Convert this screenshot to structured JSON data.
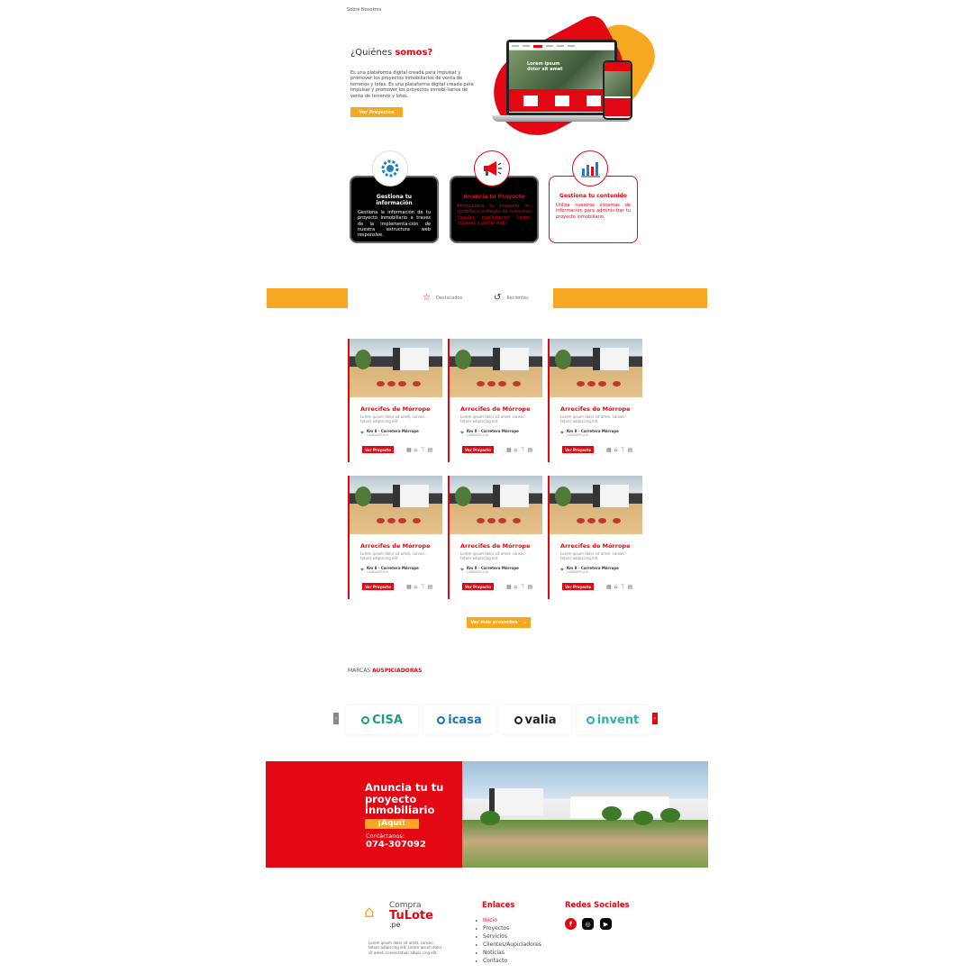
{
  "breadcrumb": "Sobre Nosotros",
  "hero": {
    "title_a": "¿Quiénes ",
    "title_b": "somos?",
    "text": "Es una plataforma digital creada para impulsar y promover los proyectos inmobiliarios de venta de terrenos y lotes. Es una plataforma digital creada para impulsar y promover los proyectos inmobi-liarios de venta de terrenos y lotes.",
    "button": "Ver Proyectos",
    "mockup_headline": "Lorem ipsum dolor sit amet"
  },
  "features": [
    {
      "icon": "gear-search-icon",
      "title": "Gestiona tu información",
      "text": "Gestiona la información de tu proyecto inmobiliario a través de la implementa-ción de nuestra estructura web responsive."
    },
    {
      "icon": "megaphone-icon",
      "title": "Anuncia tu Proyecto",
      "text": "Promociona tu proyecto in-mobiliario a través de nues-tros canales publicitarios (redes sociales y portal web)"
    },
    {
      "icon": "chart-icon",
      "title": "Gestiona tu contenido",
      "text": "Utiliza nuestros sistemas de información para adminis-trar tu proyecto inmobiliario."
    }
  ],
  "tabs": {
    "featured": "Destacados",
    "recent": "Recientes"
  },
  "project_cards": [
    {
      "title": "Arrecifes de Mórrope",
      "desc": "Lorem ipsum dolor sit amet, consec-tetuer adipiscing elit.",
      "location": "Km 8 - Carretera Mórrope",
      "location_sub": "LAMBAYEQUE",
      "button": "Ver Proyecto"
    },
    {
      "title": "Arrecifes de Mórrope",
      "desc": "Lorem ipsum dolor sit amet, consec-tetuer adipiscing elit.",
      "location": "Km 8 - Carretera Mórrope",
      "location_sub": "LAMBAYEQUE",
      "button": "Ver Proyecto"
    },
    {
      "title": "Arrecifes de Mórrope",
      "desc": "Lorem ipsum dolor sit amet, consec-tetuer adipiscing elit.",
      "location": "Km 8 - Carretera Mórrope",
      "location_sub": "LAMBAYEQUE",
      "button": "Ver Proyecto"
    },
    {
      "title": "Arrecifes de Mórrope",
      "desc": "Lorem ipsum dolor sit amet, consec-tetuer adipiscing elit.",
      "location": "Km 8 - Carretera Mórrope",
      "location_sub": "LAMBAYEQUE",
      "button": "Ver Proyecto"
    },
    {
      "title": "Arrecifes de Mórrope",
      "desc": "Lorem ipsum dolor sit amet, consec-tetuer adipiscing elit.",
      "location": "Km 8 - Carretera Mórrope",
      "location_sub": "LAMBAYEQUE",
      "button": "Ver Proyecto"
    },
    {
      "title": "Arrecifes de Mórrope",
      "desc": "Lorem ipsum dolor sit amet, consec-tetuer adipiscing elit.",
      "location": "Km 8 - Carretera Mórrope",
      "location_sub": "LAMBAYEQUE",
      "button": "Ver Proyecto"
    }
  ],
  "more_button": "Ver más proyectos",
  "sponsors": {
    "title_a": "MARCAS ",
    "title_b": "AUSPICIADORAS",
    "logos": [
      {
        "name": "CISA",
        "color": "#1d9e7a"
      },
      {
        "name": "icasa",
        "color": "#1f6fb2"
      },
      {
        "name": "valia",
        "color": "#222222"
      },
      {
        "name": "invent",
        "color": "#2bb5a0"
      }
    ]
  },
  "banner": {
    "title": "Anuncia tu tu proyecto inmobiliario",
    "aqui": "¡Aquí!",
    "contact_label": "Contáctanos:",
    "phone": "074-307092"
  },
  "footer": {
    "logo_line1": "Compra",
    "logo_line2": "TuLote",
    "logo_line3": ".pe",
    "about": "Lorem ipsum dolor sit amet, consec-tetuer adipiscing elit. Lorem ipsum dolor sit amet, consectetuer adipis-cing elit.",
    "links_title": "Enlaces",
    "links": [
      "Inicio",
      "Proyectos",
      "Servicios",
      "Clientes/Aupiciadores",
      "Noticias",
      "Contacto"
    ],
    "social_title": "Redes Sociales",
    "social": [
      "facebook-icon",
      "instagram-icon",
      "youtube-icon"
    ]
  },
  "colors": {
    "brand_red": "#e30613",
    "brand_orange": "#f7a823"
  }
}
